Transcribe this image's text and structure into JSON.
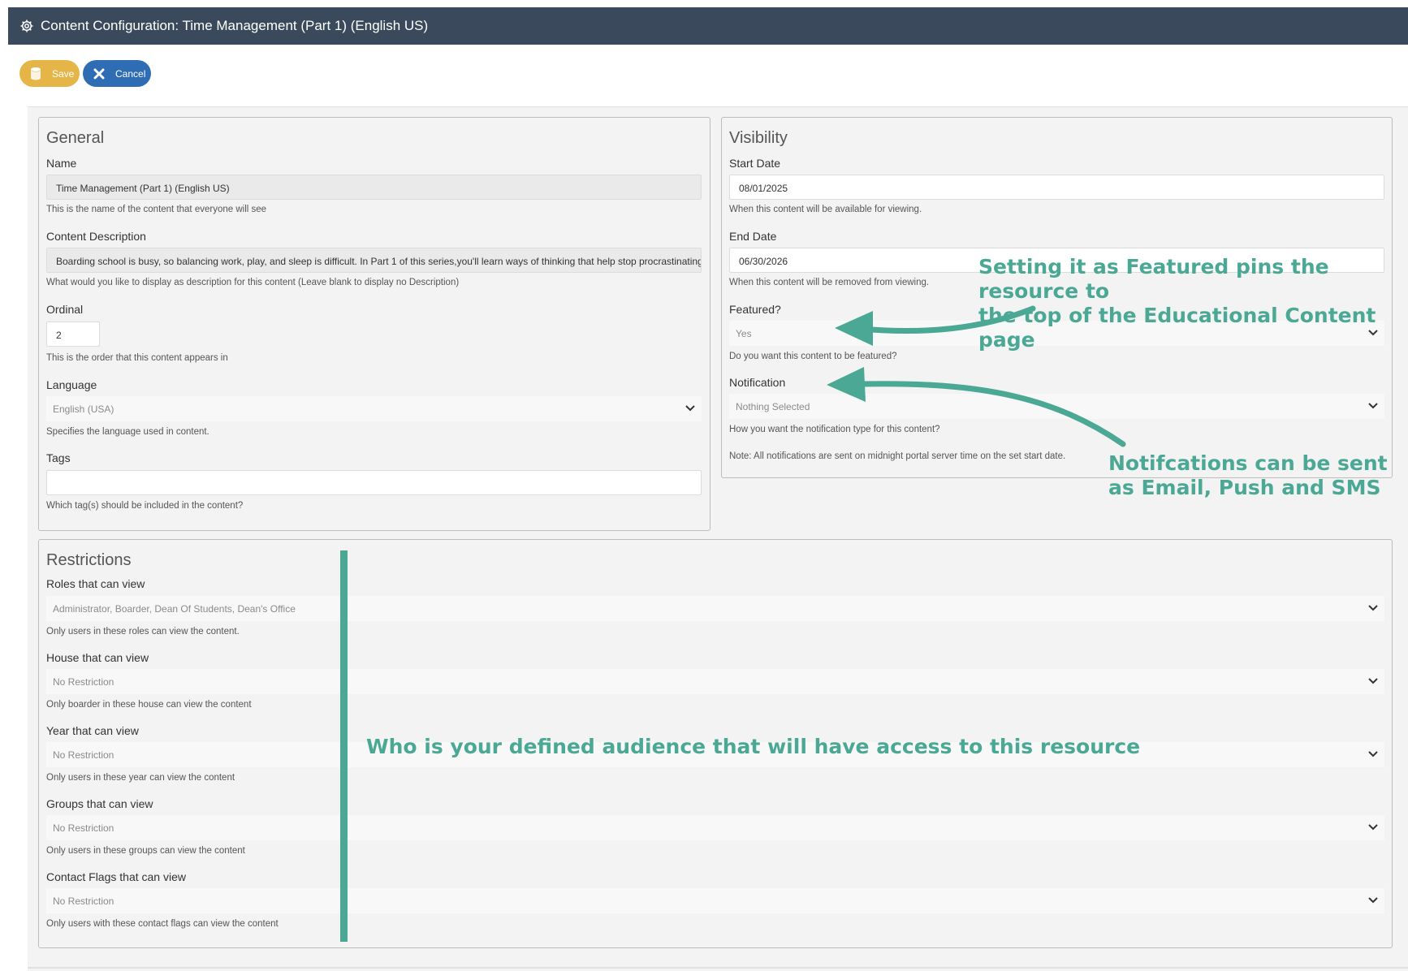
{
  "header": {
    "title": "Content Configuration: Time Management (Part 1) (English US)"
  },
  "toolbar": {
    "save_label": "Save",
    "cancel_label": "Cancel"
  },
  "general": {
    "heading": "General",
    "name_label": "Name",
    "name_value": "Time Management (Part 1) (English US)",
    "name_help": "This is the name of the content that everyone will see",
    "desc_label": "Content Description",
    "desc_value": "Boarding school is busy, so balancing work, play, and sleep is difficult. In Part 1 of this series,you'll learn ways of thinking that help stop procrastinating",
    "desc_help": "What would you like to display as description for this content (Leave blank to display no Description)",
    "ordinal_label": "Ordinal",
    "ordinal_value": "2",
    "ordinal_help": "This is the order that this content appears in",
    "language_label": "Language",
    "language_value": "English (USA)",
    "language_help": "Specifies the language used in content.",
    "tags_label": "Tags",
    "tags_value": "",
    "tags_help": "Which tag(s) should be included in the content?"
  },
  "visibility": {
    "heading": "Visibility",
    "start_label": "Start Date",
    "start_value": "08/01/2025",
    "start_help": "When this content will be available for viewing.",
    "end_label": "End Date",
    "end_value": "06/30/2026",
    "end_help": "When this content will be removed from viewing.",
    "featured_label": "Featured?",
    "featured_value": "Yes",
    "featured_help": "Do you want this content to be featured?",
    "notification_label": "Notification",
    "notification_value": "Nothing Selected",
    "notification_help": "How you want the notification type for this content?",
    "notification_note": "Note: All notifications are sent on midnight portal server time on the set start date."
  },
  "restrictions": {
    "heading": "Restrictions",
    "items": [
      {
        "label": "Roles that can view",
        "value": "Administrator, Boarder, Dean Of Students, Dean's Office",
        "help": "Only users in these roles can view the content."
      },
      {
        "label": "House that can view",
        "value": "No Restriction",
        "help": "Only boarder in these house can view the content"
      },
      {
        "label": "Year that can view",
        "value": "No Restriction",
        "help": "Only users in these year can view the content"
      },
      {
        "label": "Groups that can view",
        "value": "No Restriction",
        "help": "Only users in these groups can view the content"
      },
      {
        "label": "Contact Flags that can view",
        "value": "No Restriction",
        "help": "Only users with these contact flags can view the content"
      }
    ]
  },
  "annotations": {
    "featured_line1": "Setting it as Featured pins the resource to",
    "featured_line2": "the top of the Educational Content page",
    "notif_line1": "Notifcations can be sent",
    "notif_line2": "as Email, Push and SMS",
    "audience": "Who is your defined audience that will have access to this resource"
  },
  "colors": {
    "header_bg": "#3a4a5c",
    "save": "#e6b548",
    "cancel": "#2e6db4",
    "annotation": "#4aa894"
  },
  "icons": {
    "title": "gear-icon",
    "save": "database-icon",
    "cancel": "close-icon",
    "select": "chevron-down-icon"
  }
}
